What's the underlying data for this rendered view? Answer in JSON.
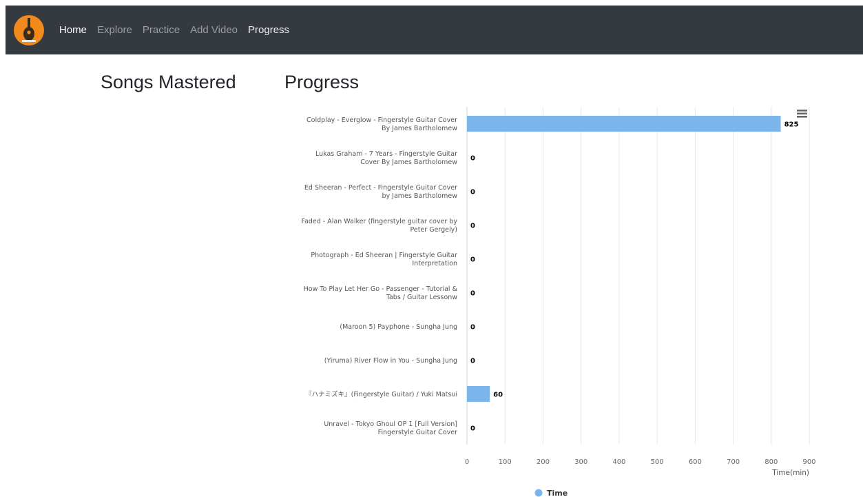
{
  "nav": {
    "items": [
      {
        "label": "Home",
        "state": "active"
      },
      {
        "label": "Explore",
        "state": "muted"
      },
      {
        "label": "Practice",
        "state": "muted"
      },
      {
        "label": "Add Video",
        "state": "muted"
      },
      {
        "label": "Progress",
        "state": "bright"
      }
    ]
  },
  "sections": {
    "mastered_title": "Songs Mastered",
    "progress_title": "Progress"
  },
  "colors": {
    "navbar": "#343a40",
    "logo": "#f08a1c",
    "bar": "#7cb5ec"
  },
  "chart_data": {
    "type": "bar",
    "orientation": "horizontal",
    "categories": [
      [
        "Coldplay - Everglow - Fingerstyle Guitar Cover",
        "By James Bartholomew"
      ],
      [
        "Lukas Graham - 7 Years - Fingerstyle Guitar",
        "Cover By James Bartholomew"
      ],
      [
        "Ed Sheeran - Perfect - Fingerstyle Guitar Cover",
        "by James Bartholomew"
      ],
      [
        "Faded - Alan Walker (fingerstyle guitar cover by",
        "Peter Gergely)"
      ],
      [
        "Photograph - Ed Sheeran | Fingerstyle Guitar",
        "Interpretation"
      ],
      [
        "How To Play Let Her Go - Passenger - Tutorial &",
        "Tabs / Guitar Lessonw"
      ],
      [
        "(Maroon 5) Payphone - Sungha Jung"
      ],
      [
        "(Yiruma) River Flow in You - Sungha Jung"
      ],
      [
        "『ハナミズキ』(Fingerstyle Guitar) / Yuki Matsui"
      ],
      [
        "Unravel - Tokyo Ghoul OP 1 [Full Version]",
        "Fingerstyle Guitar Cover"
      ]
    ],
    "series": [
      {
        "name": "Time",
        "values": [
          825,
          0,
          0,
          0,
          0,
          0,
          0,
          0,
          60,
          0
        ]
      }
    ],
    "x_ticks": [
      0,
      100,
      200,
      300,
      400,
      500,
      600,
      700,
      800,
      900
    ],
    "xlim": [
      0,
      900
    ],
    "value_axis_label": "Time(min)",
    "grid": true,
    "data_labels": true,
    "legend": "bottom-center",
    "menu_icon": "hamburger-icon"
  }
}
